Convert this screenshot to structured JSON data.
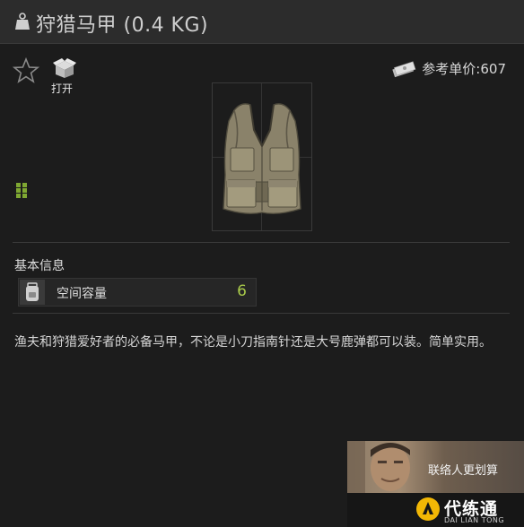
{
  "header": {
    "title": "狩猎马甲 (0.4 KG)",
    "icon": "weight-icon"
  },
  "actions": {
    "favorite_icon": "star-icon",
    "open_icon": "box-open-icon",
    "open_label": "打开"
  },
  "price": {
    "icon": "money-icon",
    "label": "参考单价:",
    "value": "607"
  },
  "item": {
    "image": "hunting-vest",
    "size_icon": "grid-size-icon"
  },
  "info": {
    "section_title": "基本信息",
    "stats": [
      {
        "icon": "backpack-icon",
        "label": "空间容量",
        "value": "6"
      }
    ]
  },
  "description": "渔夫和狩猎爱好者的必备马甲，不论是小刀指南针还是大号鹿弹都可以装。简单实用。",
  "promo": {
    "caption": "联络人更划算",
    "brand": "代练通",
    "brand_sub": "DAI LIAN TONG"
  },
  "colors": {
    "background": "#1c1c1c",
    "titlebar": "#2c2c2c",
    "stat_value": "#a8c94a",
    "accent_green": "#7fa832",
    "promo_logo": "#f2b705"
  }
}
